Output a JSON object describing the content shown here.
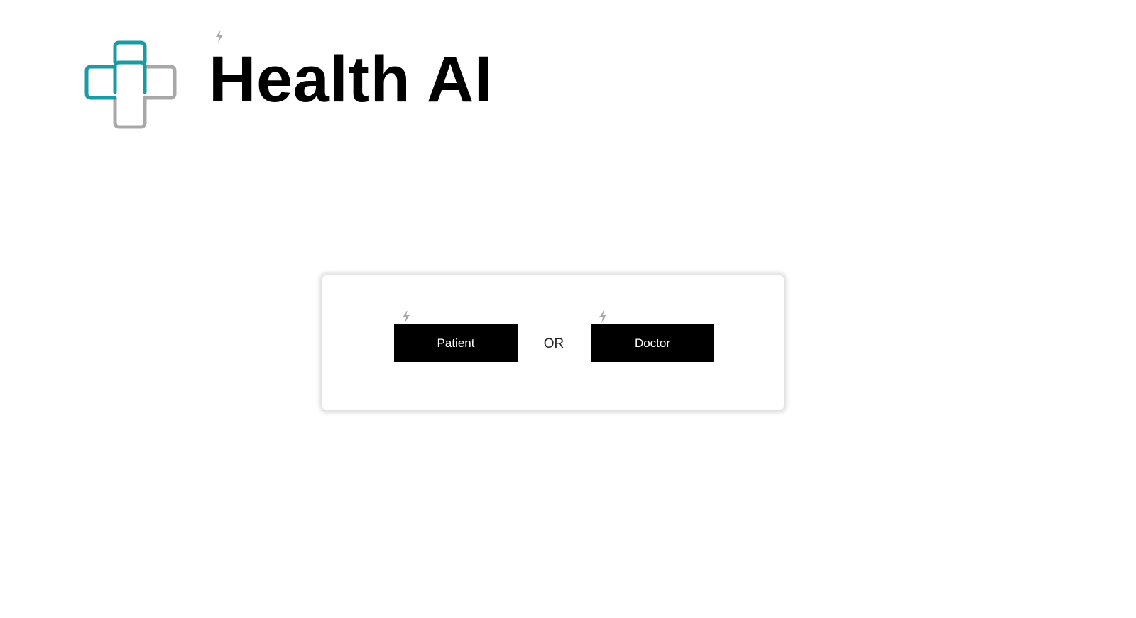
{
  "brand": {
    "title": "Health AI",
    "logo_icon": "medical-cross-logo",
    "colors": {
      "logo_primary": "#1a9ba3",
      "logo_secondary": "#a8a8a8",
      "bolt": "#a8a8a8"
    }
  },
  "role_select": {
    "patient_label": "Patient",
    "separator": "OR",
    "doctor_label": "Doctor",
    "button_background": "#000000",
    "button_text_color": "#ffffff"
  },
  "icons": {
    "marker": "lightning-bolt-icon"
  }
}
